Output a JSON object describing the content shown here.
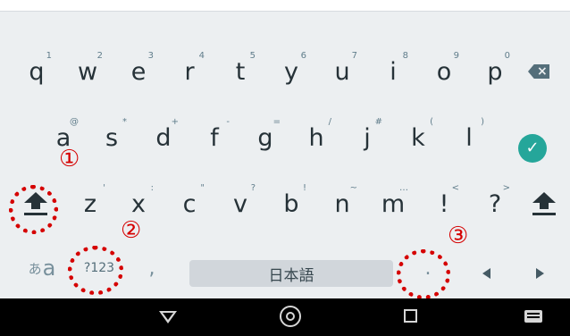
{
  "keyboard": {
    "row1": [
      {
        "key": "q",
        "hint": "1"
      },
      {
        "key": "w",
        "hint": "2"
      },
      {
        "key": "e",
        "hint": "3"
      },
      {
        "key": "r",
        "hint": "4"
      },
      {
        "key": "t",
        "hint": "5"
      },
      {
        "key": "y",
        "hint": "6"
      },
      {
        "key": "u",
        "hint": "7"
      },
      {
        "key": "i",
        "hint": "8"
      },
      {
        "key": "o",
        "hint": "9"
      },
      {
        "key": "p",
        "hint": "0"
      }
    ],
    "row2": [
      {
        "key": "a",
        "hint": "@"
      },
      {
        "key": "s",
        "hint": "*"
      },
      {
        "key": "d",
        "hint": "+"
      },
      {
        "key": "f",
        "hint": "-"
      },
      {
        "key": "g",
        "hint": "="
      },
      {
        "key": "h",
        "hint": "/"
      },
      {
        "key": "j",
        "hint": "#"
      },
      {
        "key": "k",
        "hint": "("
      },
      {
        "key": "l",
        "hint": ")"
      }
    ],
    "row3": [
      {
        "key": "z",
        "hint": "'"
      },
      {
        "key": "x",
        "hint": ":"
      },
      {
        "key": "c",
        "hint": "\""
      },
      {
        "key": "v",
        "hint": "?"
      },
      {
        "key": "b",
        "hint": "!"
      },
      {
        "key": "n",
        "hint": "~"
      },
      {
        "key": "m",
        "hint": "…"
      },
      {
        "key": "!",
        "hint": "<"
      },
      {
        "key": "?",
        "hint": ">"
      }
    ],
    "bottom": {
      "lang_small": "あ",
      "lang_main": "a",
      "symbols": "?123",
      "comma": ",",
      "space_label": "日本語",
      "period": "."
    },
    "icons": {
      "backspace": "backspace-icon",
      "enter": "checkmark-icon",
      "shift": "shift-icon",
      "cursor_left": "left-arrow-icon",
      "cursor_right": "right-arrow-icon"
    },
    "colors": {
      "background": "#eceff1",
      "enter": "#25a69a",
      "annotation": "#d50000"
    }
  },
  "annotations": [
    {
      "label": "①"
    },
    {
      "label": "②"
    },
    {
      "label": "③"
    }
  ],
  "navbar": {
    "icons": [
      "back-icon",
      "home-icon",
      "recent-apps-icon",
      "keyboard-switch-icon"
    ]
  }
}
